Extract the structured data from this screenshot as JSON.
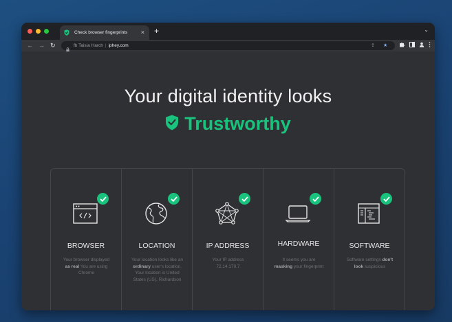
{
  "colors": {
    "accent": "#19c37d",
    "page_bg": "#2f3033",
    "tabbar_bg": "#202124"
  },
  "browser": {
    "tab_title": "Check browser fingerprints",
    "tab_close": "×",
    "new_tab": "+",
    "tabs_menu": "⌄",
    "url_profile": "fb Taisia Harch",
    "url_separator": "|",
    "url_domain": "iphey.com",
    "icons": [
      "back-icon",
      "forward-icon",
      "reload-icon",
      "lock-icon",
      "share-icon",
      "bookmark-star-icon",
      "extensions-icon",
      "sidebar-icon",
      "profile-icon",
      "menu-icon"
    ]
  },
  "hero": {
    "headline": "Your digital identity looks",
    "verdict": "Trustworthy"
  },
  "cards": [
    {
      "title": "BROWSER",
      "icon": "code-window-icon",
      "desc": [
        {
          "t": "Your browser displayed "
        },
        {
          "t": "as real",
          "b": true
        },
        {
          "t": " You are using Chrome"
        }
      ]
    },
    {
      "title": "LOCATION",
      "icon": "globe-icon",
      "desc": [
        {
          "t": "Your location looks like an "
        },
        {
          "t": "ordinary",
          "b": true
        },
        {
          "t": " user's location. Your location is United States (US), Richardson"
        }
      ]
    },
    {
      "title": "IP ADDRESS",
      "icon": "network-icon",
      "desc": [
        {
          "t": "Your IP address 72.14.170.7"
        }
      ]
    },
    {
      "title": "HARDWARE",
      "icon": "laptop-icon",
      "desc": [
        {
          "t": "It seems you are "
        },
        {
          "t": "masking",
          "b": true
        },
        {
          "t": " your fingerprint"
        }
      ]
    },
    {
      "title": "SOFTWARE",
      "icon": "software-icon",
      "desc": [
        {
          "t": "Software settings "
        },
        {
          "t": "don't look",
          "b": true
        },
        {
          "t": " suspicious"
        }
      ]
    }
  ]
}
